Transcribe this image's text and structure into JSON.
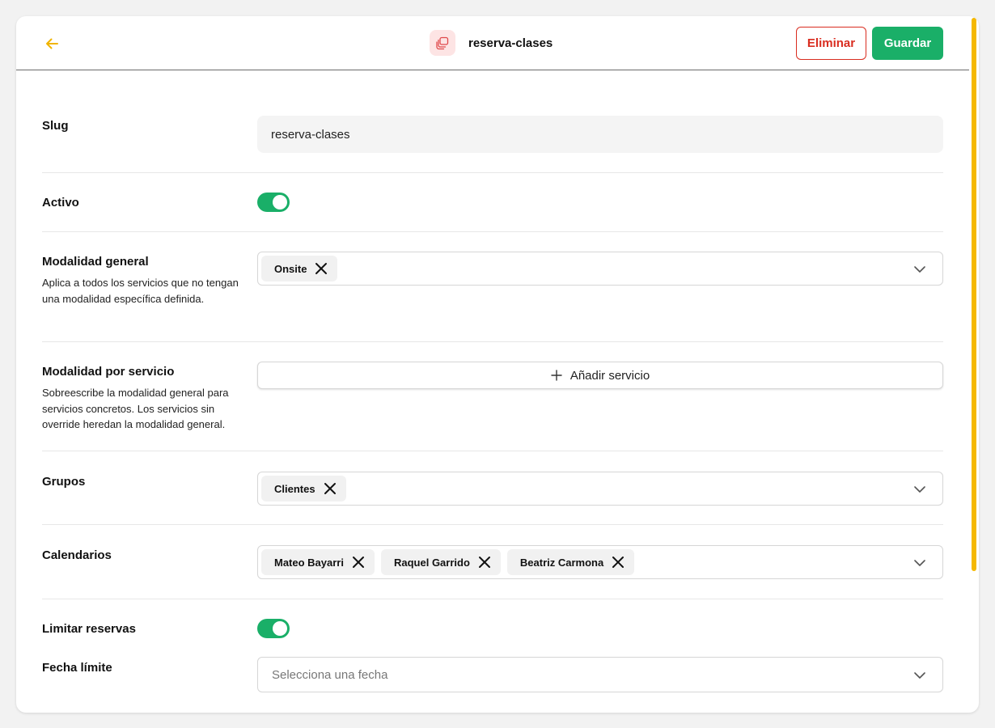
{
  "header": {
    "title": "reserva-clases",
    "delete_label": "Eliminar",
    "save_label": "Guardar"
  },
  "colors": {
    "accent_green": "#1aaf68",
    "danger_red": "#d92d20",
    "back_arrow": "#f0b400",
    "scrollbar": "#f5b800"
  },
  "fields": {
    "slug": {
      "label": "Slug",
      "value": "reserva-clases"
    },
    "active": {
      "label": "Activo",
      "enabled": true
    },
    "general_mode": {
      "label": "Modalidad general",
      "description": "Aplica a todos los servicios que no tengan una modalidad específica definida.",
      "chips": [
        "Onsite"
      ]
    },
    "service_mode": {
      "label": "Modalidad por servicio",
      "description": "Sobreescribe la modalidad general para servicios concretos. Los servicios sin override heredan la modalidad general.",
      "add_label": "Añadir servicio"
    },
    "groups": {
      "label": "Grupos",
      "chips": [
        "Clientes"
      ]
    },
    "calendars": {
      "label": "Calendarios",
      "chips": [
        "Mateo Bayarri",
        "Raquel Garrido",
        "Beatriz Carmona"
      ]
    },
    "limit_bookings": {
      "label": "Limitar reservas",
      "enabled": true
    },
    "deadline": {
      "label": "Fecha límite",
      "placeholder": "Selecciona una fecha"
    }
  },
  "icons": {
    "back": "arrow-left-icon",
    "title": "layers-icon",
    "chip_remove": "close-icon",
    "dropdown": "chevron-down-icon",
    "add": "plus-icon"
  }
}
